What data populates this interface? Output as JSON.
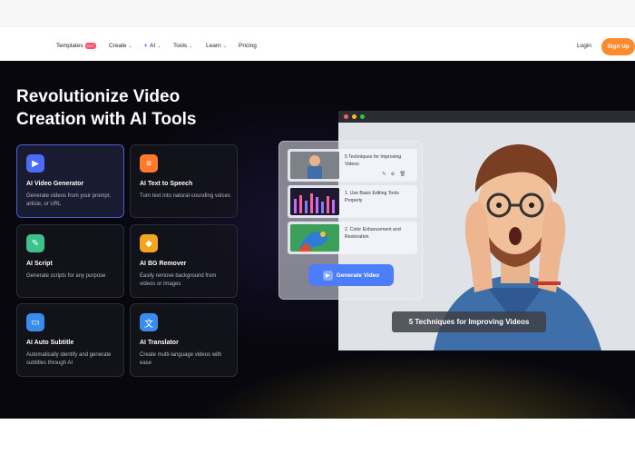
{
  "nav": {
    "templates": "Templates",
    "templates_badge": "HOT",
    "create": "Create",
    "ai": "AI",
    "tools": "Tools",
    "learn": "Learn",
    "pricing": "Pricing",
    "login": "Login",
    "signup": "Sign Up"
  },
  "hero": {
    "title": "Revolutionize Video Creation with AI Tools"
  },
  "cards": [
    {
      "title": "AI Video Generator",
      "desc": "Generate videos from your prompt, article, or URL",
      "icon": "video-generator-icon",
      "color": "#4a6cf7"
    },
    {
      "title": "AI Text to Speech",
      "desc": "Turn text into natural-sounding voices",
      "icon": "text-to-speech-icon",
      "color": "#ff7a2b"
    },
    {
      "title": "AI Script",
      "desc": "Generate scripts for any purpose",
      "icon": "script-icon",
      "color": "#3cc28a"
    },
    {
      "title": "AI BG Remover",
      "desc": "Easily remove background from videos or images",
      "icon": "bg-remover-icon",
      "color": "#f2a51d"
    },
    {
      "title": "AI Auto Subtitle",
      "desc": "Automatically identify and generate subtitles through AI",
      "icon": "subtitle-icon",
      "color": "#3a8bf0"
    },
    {
      "title": "AI Translator",
      "desc": "Create multi-language videos with ease",
      "icon": "translator-icon",
      "color": "#3a8bf0"
    }
  ],
  "preview": {
    "items": [
      {
        "text": "5 Techniques for Improving Videos"
      },
      {
        "text": "1. Use Basic Editing Tools Properly"
      },
      {
        "text": "2. Color Enhancement and Restoration"
      }
    ],
    "generate_button": "Generate Video",
    "caption": "5 Techniques for Improving Videos"
  }
}
